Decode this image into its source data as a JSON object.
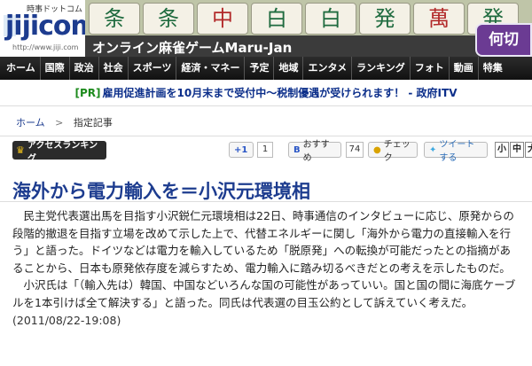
{
  "header": {
    "logo_top": "時事ドットコム",
    "logo_main": "jijicom",
    "logo_url": "http://www.jiji.com",
    "banner_tiles": [
      "条",
      "条",
      "中",
      "白",
      "白",
      "発",
      "萬",
      "発"
    ],
    "banner_text": "オンライン麻雀ゲームMaru-Jan",
    "banner_button": "何切"
  },
  "nav": {
    "items": [
      "ホーム",
      "国際",
      "政治",
      "社会",
      "スポーツ",
      "経済・マネー",
      "予定",
      "地域",
      "エンタメ",
      "ランキング",
      "フォト",
      "動画",
      "特集"
    ]
  },
  "pr": {
    "tag": "[PR]",
    "text": "雇用促進計画を10月末まで受付中～税制優遇が受けられます！ - 政府ITV"
  },
  "breadcrumb": {
    "home": "ホーム",
    "separator": ">",
    "current": "指定記事"
  },
  "toolbar": {
    "ranking_label": "アクセスランキング",
    "gplus_label": "+1",
    "gplus_count": "1",
    "hatena_label": "おすすめ",
    "hatena_count": "74",
    "check_label": "チェック",
    "tweet_label": "ツイートする",
    "size_small": "小",
    "size_mid": "中",
    "size_large": "大"
  },
  "article": {
    "title": "海外から電力輸入を＝小沢元環境相",
    "paragraph1": "民主党代表選出馬を目指す小沢鋭仁元環境相は22日、時事通信のインタビューに応じ、原発からの段階的撤退を目指す立場を改めて示した上で、代替エネルギーに関し「海外から電力の直接輸入を行う」と語った。ドイツなどは電力を輸入しているため「脱原発」への転換が可能だったとの指摘があることから、日本も原発依存度を減らすため、電力輸入に踏み切るべきだとの考えを示したものだ。",
    "paragraph2": "小沢氏は「（輸入先は）韓国、中国などいろんな国の可能性があっていい。国と国の間に海底ケーブルを1本引けば全て解決する」と語った。同氏は代表選の目玉公約として訴えていく考えだ。",
    "date": "(2011/08/22-19:08)"
  },
  "colors": {
    "brand": "#1d3c8f",
    "nav_bg": "#1a1a1a",
    "pr_tag": "#1c8a1c",
    "banner_button": "#6b3b93"
  }
}
